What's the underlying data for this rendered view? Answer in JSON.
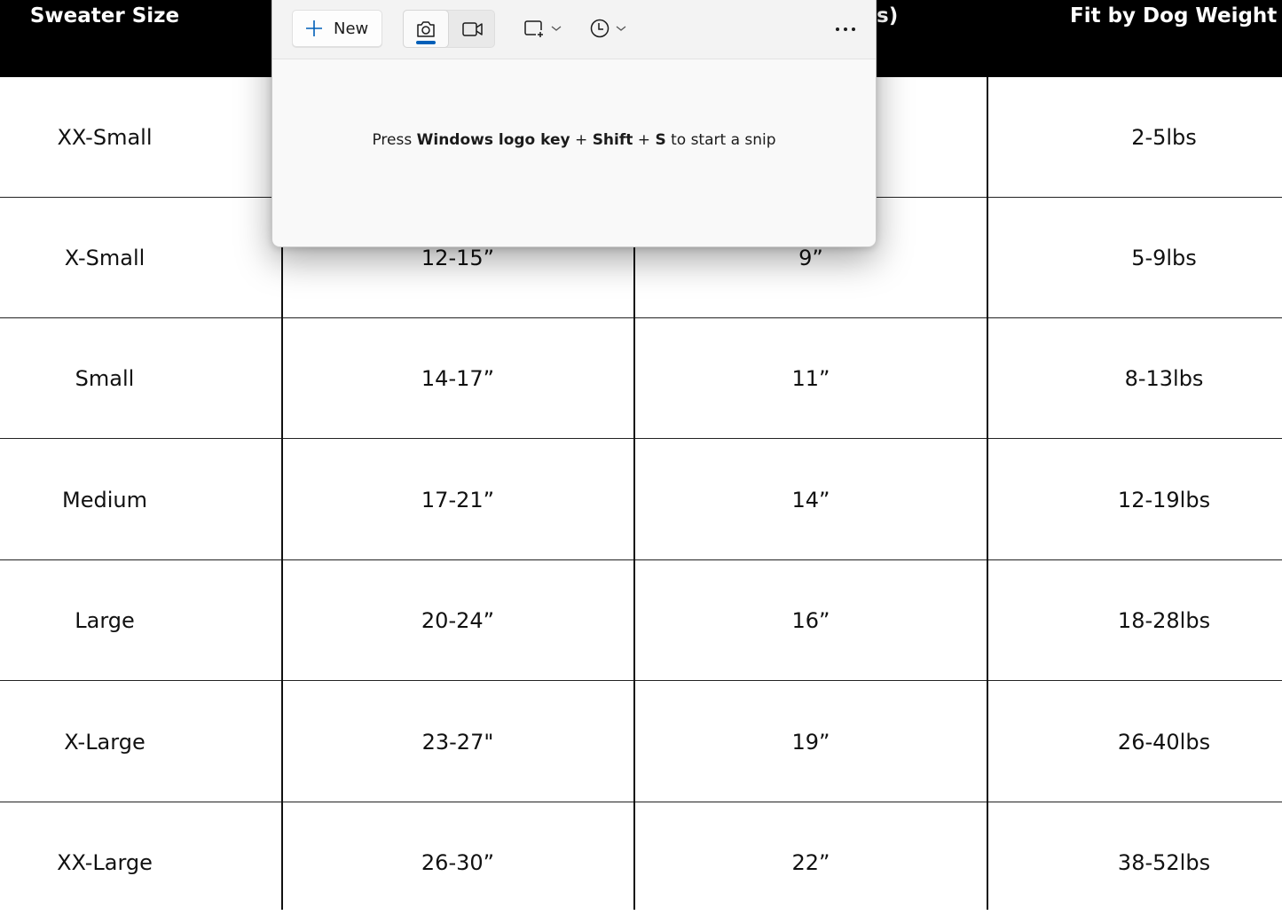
{
  "size_chart": {
    "headers": [
      "Sweater Size",
      "",
      "",
      "Fit by Dog Weight"
    ],
    "header_partial_visible": "s)",
    "rows": [
      {
        "size": "XX-Small",
        "col1": "",
        "col2": "",
        "weight": "2-5lbs"
      },
      {
        "size": "X-Small",
        "col1": "12-15”",
        "col2": "9”",
        "weight": "5-9lbs"
      },
      {
        "size": "Small",
        "col1": "14-17”",
        "col2": "11”",
        "weight": "8-13lbs"
      },
      {
        "size": "Medium",
        "col1": "17-21”",
        "col2": "14”",
        "weight": "12-19lbs"
      },
      {
        "size": "Large",
        "col1": "20-24”",
        "col2": "16”",
        "weight": "18-28lbs"
      },
      {
        "size": "X-Large",
        "col1": "23-27\"",
        "col2": "19”",
        "weight": "26-40lbs"
      },
      {
        "size": "XX-Large",
        "col1": "26-30”",
        "col2": "22”",
        "weight": "38-52lbs"
      }
    ]
  },
  "snipping_tool": {
    "new_button": {
      "label": "New",
      "icon": "plus-icon"
    },
    "modes": [
      {
        "name": "screenshot",
        "icon": "camera-icon",
        "selected": true
      },
      {
        "name": "record",
        "icon": "video-camera-icon",
        "selected": false
      }
    ],
    "shape_dropdown_icon": "rectangle-snip-icon",
    "timer_dropdown_icon": "clock-icon",
    "more_icon": "more-options-icon",
    "hint": {
      "prefix": "Press ",
      "key1": "Windows logo key",
      "plus1": " + ",
      "key2": "Shift",
      "plus2": " + ",
      "key3": "S",
      "suffix": " to start a snip"
    },
    "accent_color": "#005fb8"
  }
}
